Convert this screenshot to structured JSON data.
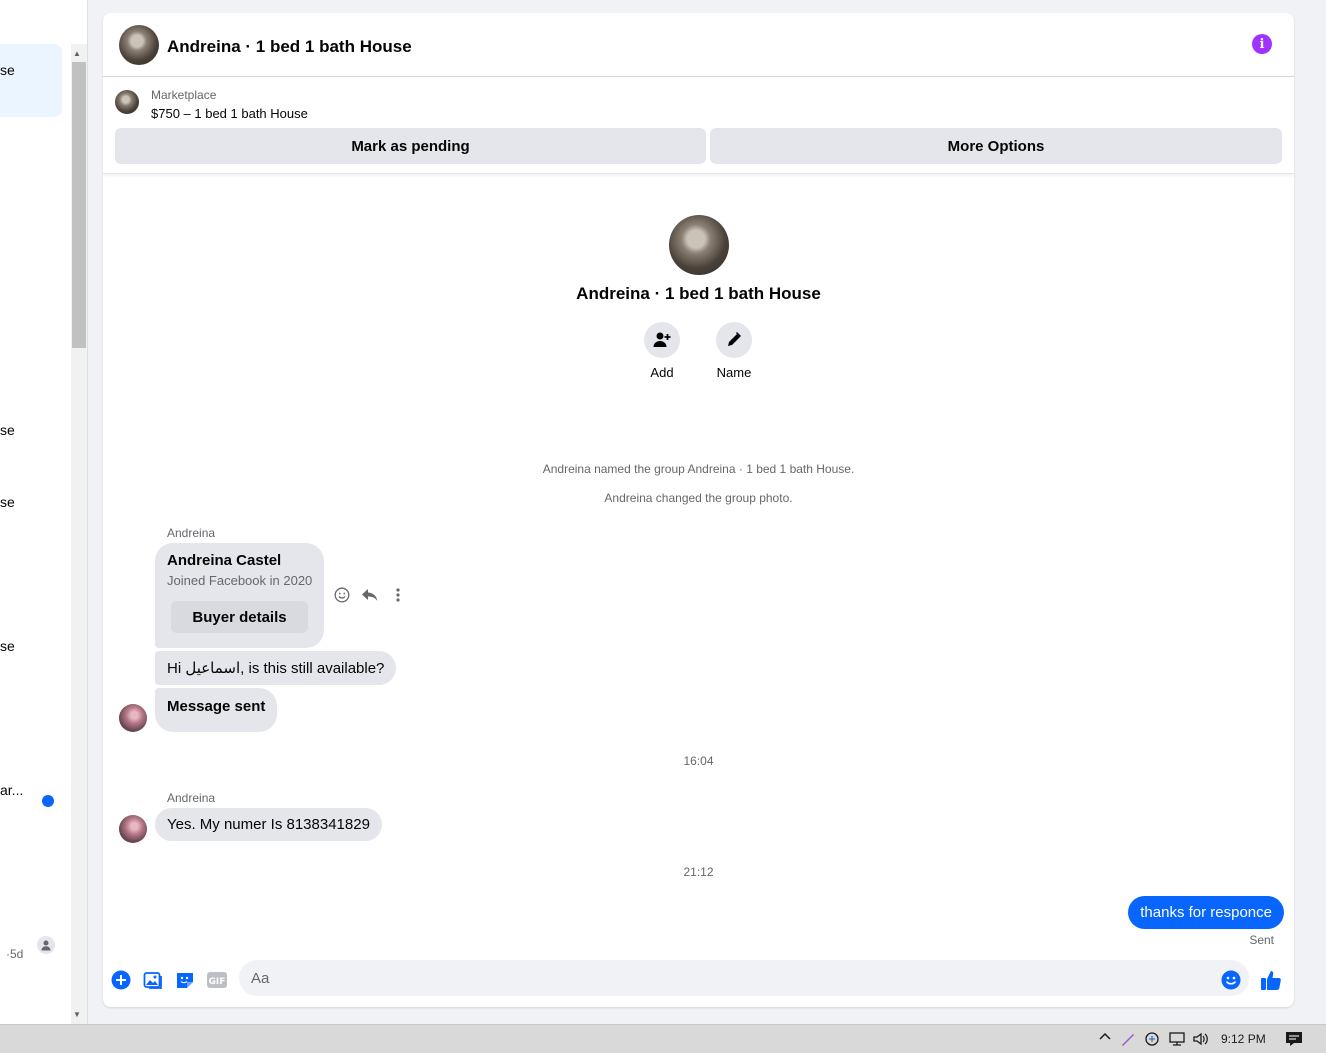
{
  "sidebar": {
    "fragments": [
      "se",
      "se",
      "se",
      "se",
      "ar..."
    ],
    "last_time": "·5d"
  },
  "chat": {
    "title": "Andreina · 1 bed 1 bath House",
    "marketplace": {
      "label": "Marketplace",
      "listing": "$750 – 1 bed 1 bath House",
      "mark_pending": "Mark as pending",
      "more_options": "More Options"
    },
    "profile": {
      "name": "Andreina · 1 bed 1 bath House",
      "add_label": "Add",
      "name_label": "Name"
    },
    "system_messages": [
      "Andreina named the group Andreina · 1 bed 1 bath House.",
      "Andreina changed the group photo."
    ],
    "sender_name": "Andreina",
    "buyer_card": {
      "name": "Andreina Castel",
      "joined": "Joined Facebook in 2020",
      "button": "Buyer details"
    },
    "messages": {
      "m1": "Hi اسماعيل, is this still available?",
      "m2": "Message sent",
      "m3": "Yes. My numer Is 8138341829",
      "outgoing": "thanks for responce"
    },
    "times": [
      "16:04",
      "21:12"
    ],
    "sent_status": "Sent",
    "composer": {
      "placeholder": "Aa",
      "value": ""
    },
    "colors": {
      "accent": "#0866ff",
      "info": "#a033ff",
      "bubble": "#e4e6eb"
    }
  },
  "taskbar": {
    "time": "9:12 PM"
  }
}
